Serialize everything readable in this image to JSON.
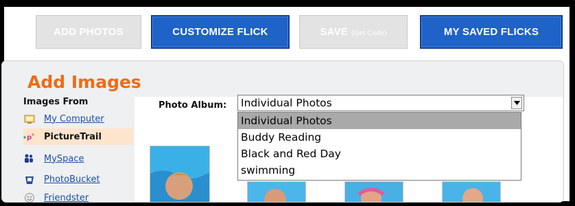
{
  "toolbar": {
    "add_photos": "ADD PHOTOS",
    "customize_flick": "CUSTOMIZE FLICK",
    "save": "SAVE",
    "save_note": "(Get Code)",
    "my_saved_flicks": "MY SAVED FLICKS"
  },
  "page": {
    "title": "Add Images"
  },
  "sidebar": {
    "heading": "Images From",
    "items": [
      {
        "label": "My Computer",
        "icon": "computer-icon"
      },
      {
        "label": "PictureTrail",
        "icon": "picturetrail-icon"
      },
      {
        "label": "MySpace",
        "icon": "myspace-icon"
      },
      {
        "label": "PhotoBucket",
        "icon": "photobucket-icon"
      },
      {
        "label": "Friendster",
        "icon": "friendster-icon"
      }
    ]
  },
  "album": {
    "label": "Photo Album:",
    "selected": "Individual Photos",
    "options": [
      "Individual Photos",
      "Buddy Reading",
      "Black and Red Day",
      "swimming"
    ]
  },
  "colors": {
    "accent_orange": "#ee6b15",
    "button_blue": "#1f62c8",
    "link_blue": "#1d4ea8",
    "selected_bg": "#fde4cd"
  }
}
